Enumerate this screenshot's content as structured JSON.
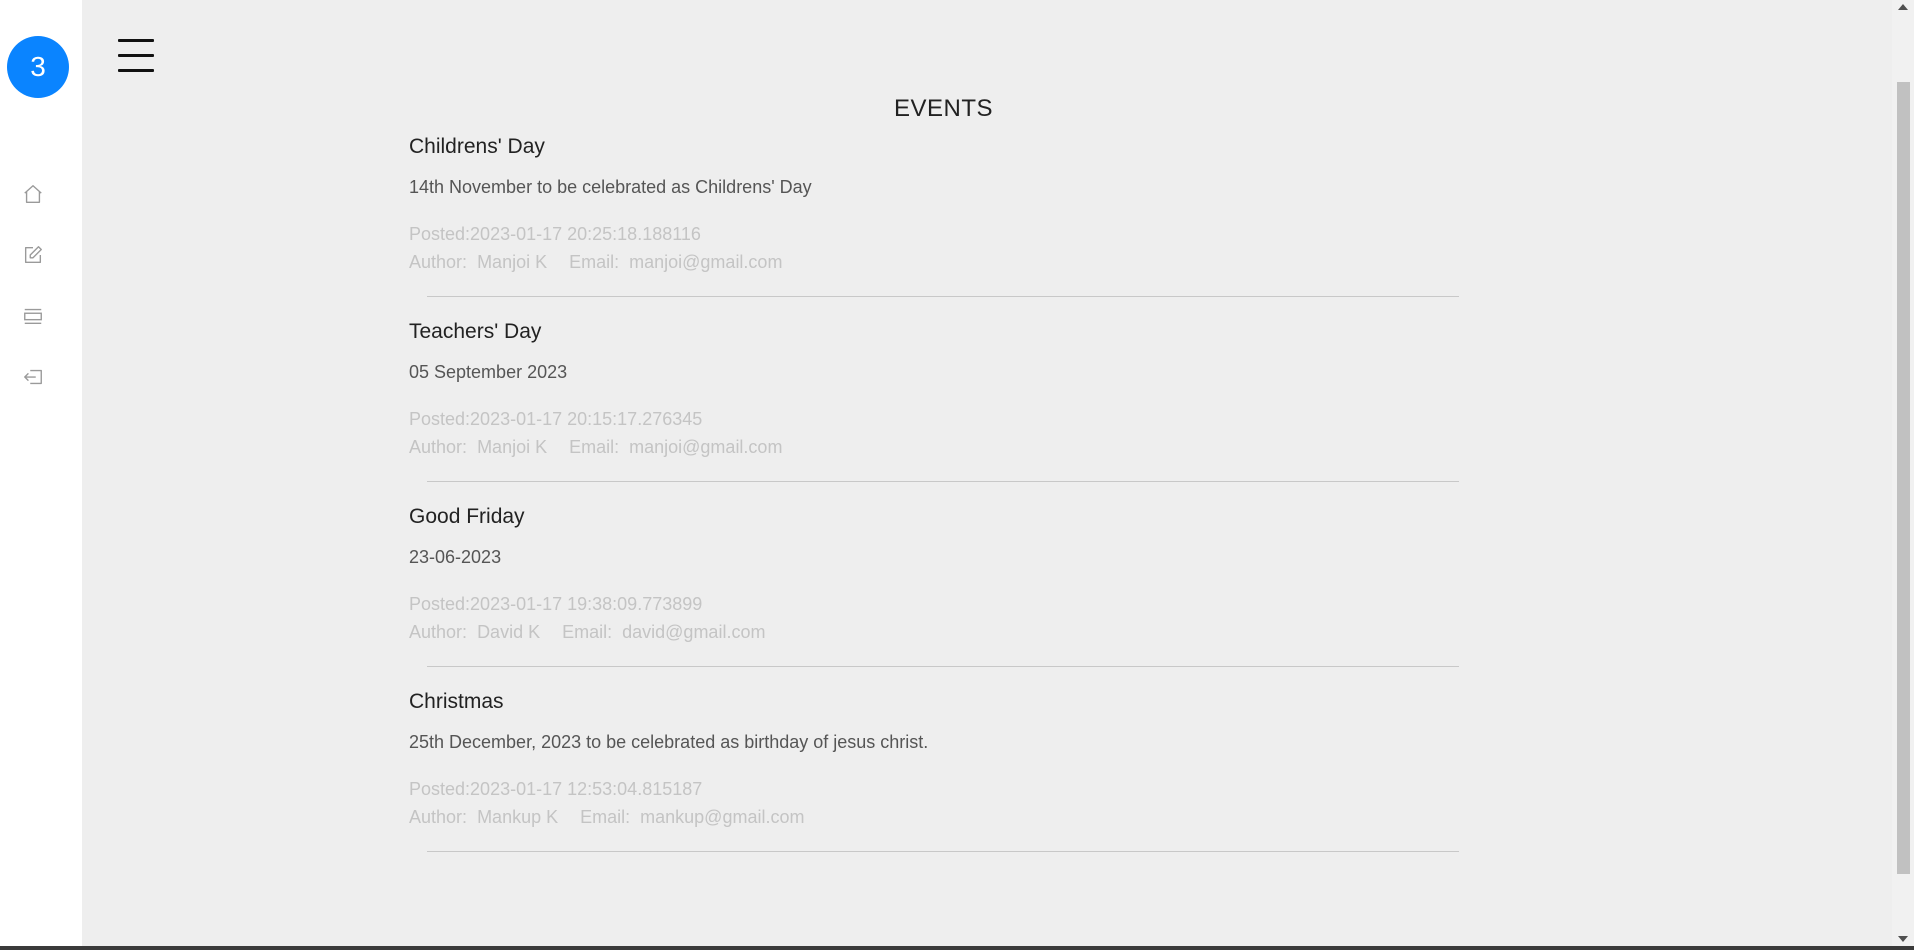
{
  "sidebar": {
    "badge": "3",
    "icons": [
      "home-icon",
      "edit-icon",
      "list-icon",
      "logout-icon"
    ]
  },
  "header": {
    "title": "EVENTS"
  },
  "labels": {
    "posted": "Posted:",
    "author": "Author:",
    "email": "Email:"
  },
  "events": [
    {
      "title": "Childrens' Day",
      "description": "14th November to be celebrated as Childrens' Day",
      "posted": "2023-01-17 20:25:18.188116",
      "author": "Manjoi K",
      "email": "manjoi@gmail.com"
    },
    {
      "title": "Teachers' Day",
      "description": "05 September 2023",
      "posted": "2023-01-17 20:15:17.276345",
      "author": "Manjoi K",
      "email": "manjoi@gmail.com"
    },
    {
      "title": "Good Friday",
      "description": "23-06-2023",
      "posted": "2023-01-17 19:38:09.773899",
      "author": "David K",
      "email": "david@gmail.com"
    },
    {
      "title": "Christmas",
      "description": "25th December, 2023 to be celebrated as birthday of jesus christ.",
      "posted": "2023-01-17 12:53:04.815187",
      "author": "Mankup K",
      "email": "mankup@gmail.com"
    }
  ],
  "colors": {
    "accent": "#0a84ff",
    "background": "#eeeeee",
    "muted_text": "#c4c4c4"
  }
}
